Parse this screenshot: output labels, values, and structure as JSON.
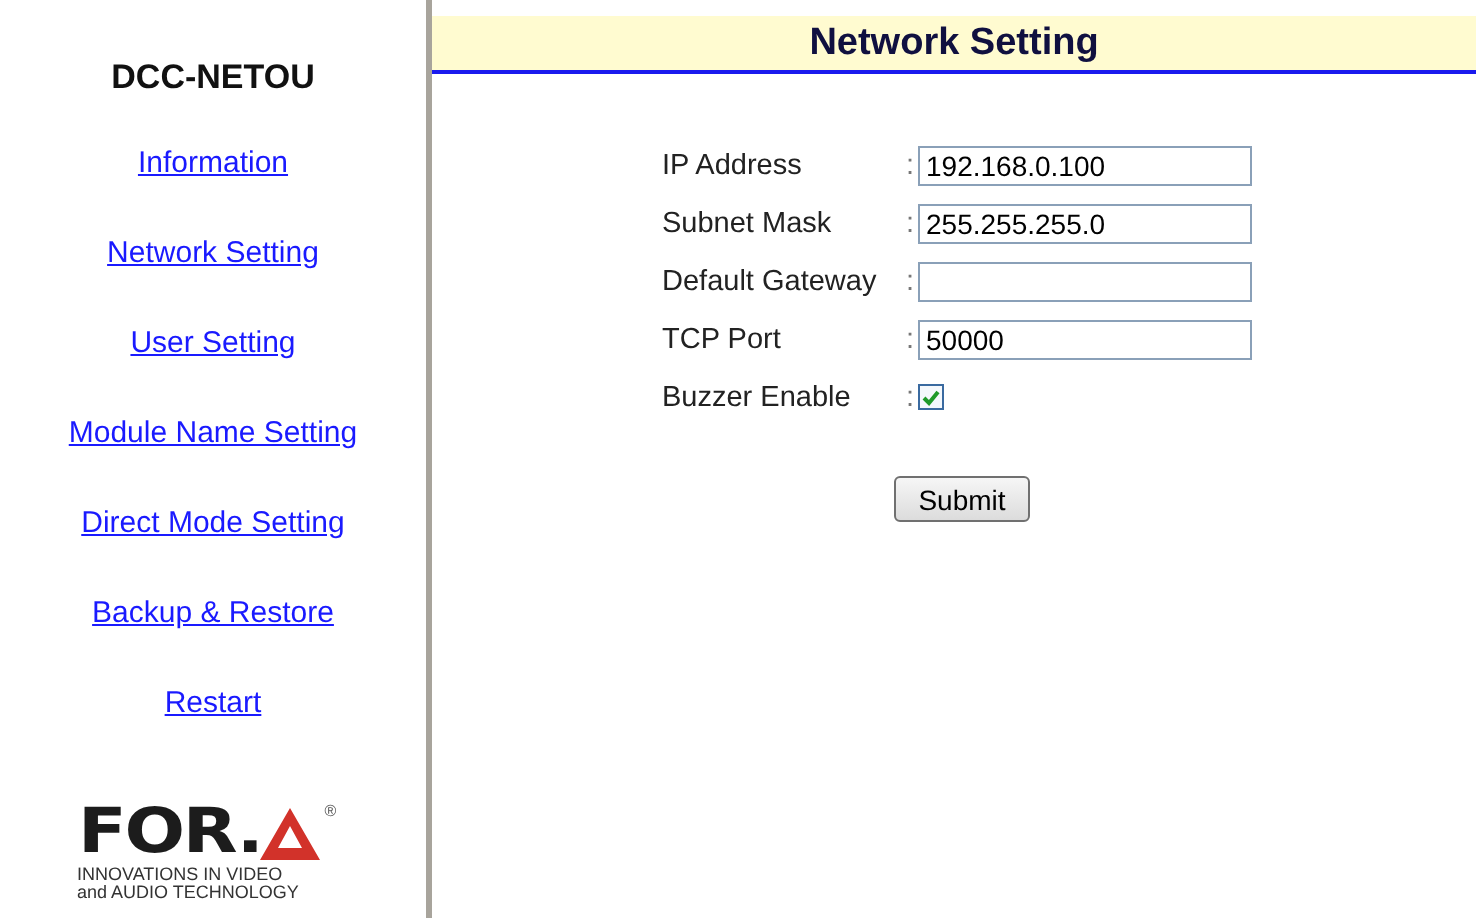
{
  "sidebar": {
    "title": "DCC-NETOU",
    "links": [
      "Information",
      "Network Setting",
      "User Setting",
      "Module Name Setting",
      "Direct Mode Setting",
      "Backup & Restore",
      "Restart"
    ],
    "logo": {
      "wordmark": "FOR.",
      "registered": "®",
      "tagline": [
        "INNOVATIONS IN VIDEO",
        "and AUDIO TECHNOLOGY"
      ]
    }
  },
  "header": {
    "title": "Network Setting"
  },
  "form": {
    "rows": [
      {
        "kind": "text",
        "label": "IP Address",
        "separator": ":",
        "value": "192.168.0.100"
      },
      {
        "kind": "text",
        "label": "Subnet Mask",
        "separator": ":",
        "value": "255.255.255.0"
      },
      {
        "kind": "text",
        "label": "Default Gateway",
        "separator": ":"
      },
      {
        "kind": "text",
        "label": "TCP Port",
        "separator": ":",
        "value": "50000"
      },
      {
        "kind": "checkbox",
        "label": "Buzzer Enable",
        "separator": ":",
        "checked": true
      }
    ],
    "submit": "Submit"
  }
}
